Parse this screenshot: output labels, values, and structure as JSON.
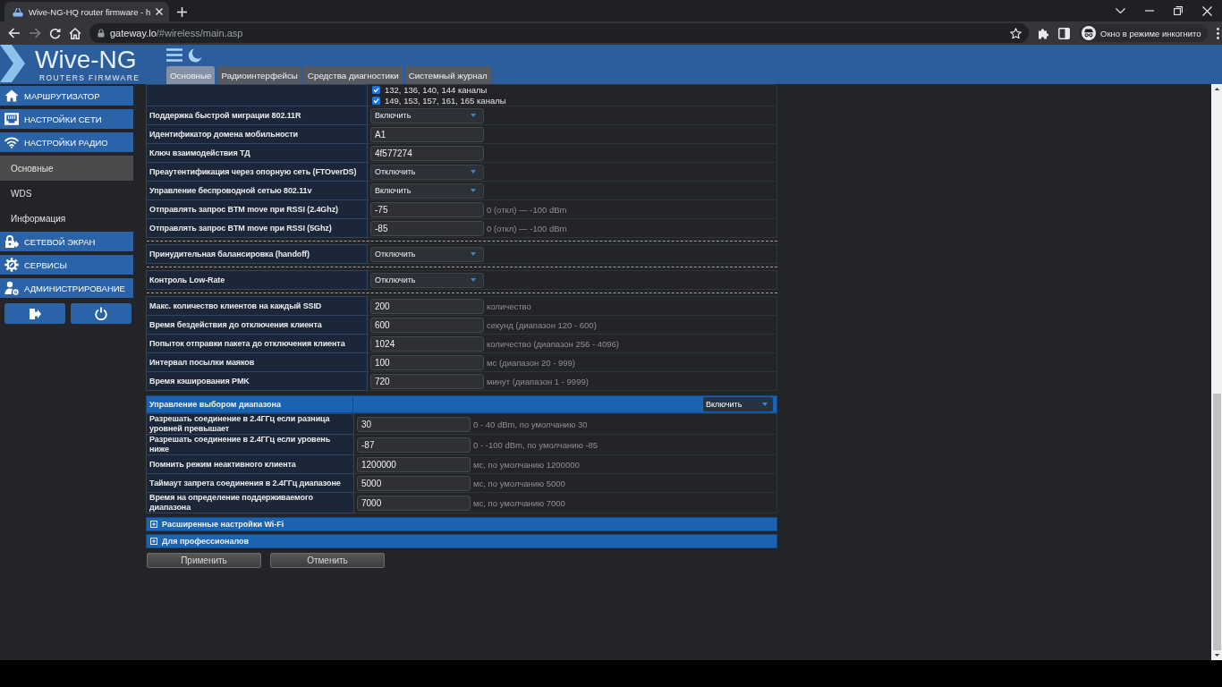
{
  "browser": {
    "tab": {
      "title": "Wive-NG-HQ router firmware - h"
    },
    "address": {
      "host": "gateway.lo",
      "path": "/#wireless/main.asp"
    },
    "profile": {
      "label": "Окно в режиме инкогнито"
    }
  },
  "header": {
    "logo": {
      "title": "Wive-NG",
      "subtitle": "ROUTERS FIRMWARE"
    },
    "tabs": [
      {
        "label": "Основные",
        "selected": true
      },
      {
        "label": "Радиоинтерфейсы",
        "selected": false
      },
      {
        "label": "Средства диагностики",
        "selected": false
      },
      {
        "label": "Системный журнал",
        "selected": false
      }
    ]
  },
  "sidebar": {
    "items": [
      {
        "kind": "section",
        "label": "МАРШРУТИЗАТОР",
        "selected": false
      },
      {
        "kind": "section",
        "label": "НАСТРОЙКИ СЕТИ",
        "selected": false
      },
      {
        "kind": "section",
        "label": "НАСТРОЙКИ РАДИО",
        "selected": false
      },
      {
        "kind": "subitem",
        "label": "Основные",
        "selected": true
      },
      {
        "kind": "subitem",
        "label": "WDS",
        "selected": false
      },
      {
        "kind": "subitem",
        "label": "Информация",
        "selected": false
      },
      {
        "kind": "section",
        "label": "СЕТЕВОЙ ЭКРАН",
        "selected": false
      },
      {
        "kind": "section",
        "label": "СЕРВИСЫ",
        "selected": false
      },
      {
        "kind": "section",
        "label": "АДМИНИСТРИРОВАНИЕ",
        "selected": false
      }
    ]
  },
  "wireless_form": {
    "channels": [
      {
        "label": "132, 136, 140, 144 каналы",
        "checked": true
      },
      {
        "label": "149, 153, 157, 161, 165 каналы",
        "checked": true
      }
    ],
    "rows": [
      {
        "kind": "select",
        "label": "Поддержка быстрой миграции 802.11R",
        "value": "Включить"
      },
      {
        "kind": "input",
        "label": "Идентификатор домена мобильности",
        "value": "A1"
      },
      {
        "kind": "input",
        "label": "Ключ взаимодействия ТД",
        "value": "4f577274"
      },
      {
        "kind": "select",
        "label": "Преаутентификация через опорную сеть (FTOverDS)",
        "value": "Отключить"
      },
      {
        "kind": "select",
        "label": "Управление беспроводной сетью 802.11v",
        "value": "Включить"
      },
      {
        "kind": "input",
        "label": "Отправлять запрос BTM move при RSSI (2.4Ghz)",
        "value": "-75",
        "hint": "0 (откл) — -100 dBm"
      },
      {
        "kind": "input",
        "label": "Отправлять запрос BTM move при RSSI (5Ghz)",
        "value": "-85",
        "hint": "0 (откл) — -100 dBm"
      },
      {
        "kind": "divider"
      },
      {
        "kind": "select",
        "label": "Принудительная балансировка (handoff)",
        "value": "Отключить"
      },
      {
        "kind": "divider"
      },
      {
        "kind": "select",
        "label": "Контроль Low-Rate",
        "value": "Отключить"
      },
      {
        "kind": "divider"
      },
      {
        "kind": "input",
        "label": "Макс. количество клиентов на каждый SSID",
        "value": "200",
        "hint": "количество"
      },
      {
        "kind": "input",
        "label": "Время бездействия до отключения клиента",
        "value": "600",
        "hint": "секунд (диапазон 120 - 600)"
      },
      {
        "kind": "input",
        "label": "Попыток отправки пакета до отключения клиента",
        "value": "1024",
        "hint": "количество (диапазон 256 - 4096)"
      },
      {
        "kind": "input",
        "label": "Интервал посылки маяков",
        "value": "100",
        "hint": "мс (диапазон 20 - 999)"
      },
      {
        "kind": "input",
        "label": "Время кэширования PMK",
        "value": "720",
        "hint": "минут (диапазон 1 - 9999)"
      }
    ]
  },
  "band_steering": {
    "title": "Управление выбором диапазона",
    "value": "Включить",
    "rows": [
      {
        "label": "Разрешать соединение в 2.4ГГц если разница уровней превышает",
        "value": "30",
        "hint": "0 - 40 dBm, по умолчанию 30"
      },
      {
        "label": "Разрешать соединение в 2.4ГГц если уровень ниже",
        "value": "-87",
        "hint": "0 - -100 dBm, по умолчанию -85"
      },
      {
        "label": "Помнить режим неактивного клиента",
        "value": "1200000",
        "hint": "мс, по умолчанию 1200000"
      },
      {
        "label": "Таймаут запрета соединения в 2.4ГГц диапазоне",
        "value": "5000",
        "hint": "мс, по умолчанию 5000"
      },
      {
        "label": "Время на определение поддерживаемого диапазона",
        "value": "7000",
        "hint": "мс, по умолчанию 7000"
      }
    ]
  },
  "sections": [
    {
      "label": "Расширенные настройки Wi-Fi",
      "expanded": false
    },
    {
      "label": "Для профессионалов",
      "expanded": false
    }
  ],
  "buttons": [
    {
      "label": "Применить"
    },
    {
      "label": "Отменить"
    }
  ]
}
